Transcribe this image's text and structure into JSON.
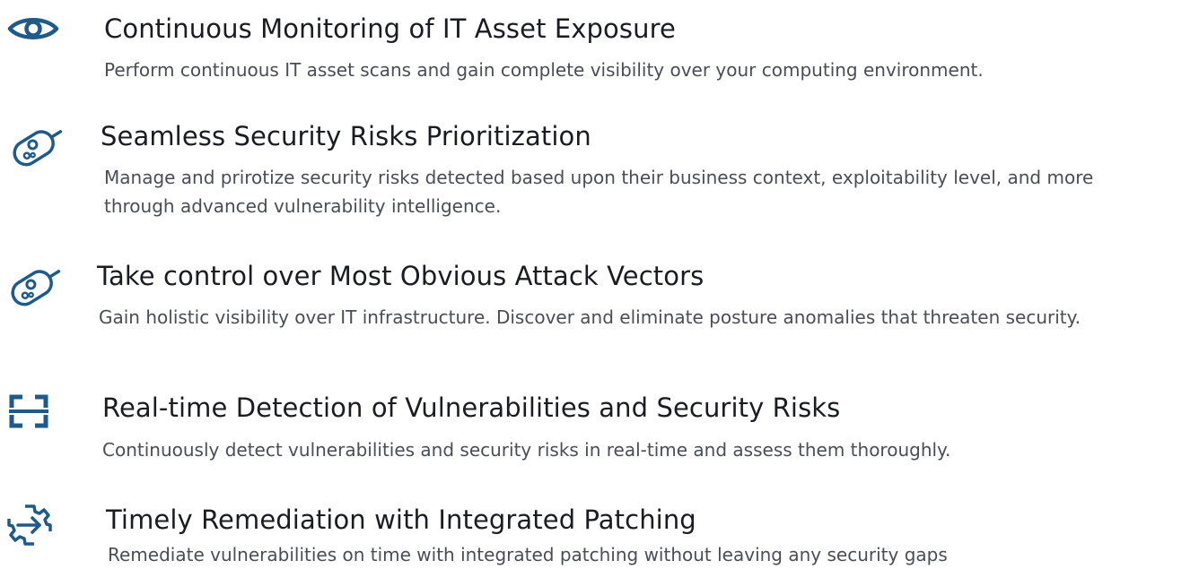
{
  "accent_color": "#1e5a8a",
  "features": [
    {
      "icon": "eye-icon",
      "title": "Continuous Monitoring of IT Asset Exposure",
      "description": "Perform continuous IT asset scans and gain complete visibility over your computing environment."
    },
    {
      "icon": "risk-meter-icon",
      "title": "Seamless Security Risks Prioritization",
      "description": "Manage and prirotize security risks detected based upon their business context, exploitability level, and more through advanced vulnerability intelligence."
    },
    {
      "icon": "risk-meter-icon",
      "title": "Take control over Most Obvious Attack Vectors",
      "description": "Gain holistic visibility over IT infrastructure. Discover and eliminate posture anomalies that threaten security."
    },
    {
      "icon": "scan-frame-icon",
      "title": "Real-time Detection of Vulnerabilities and Security Risks",
      "description": "Continuously detect vulnerabilities and security risks in real-time and assess them thoroughly."
    },
    {
      "icon": "gear-arrow-icon",
      "title": "Timely Remediation with Integrated Patching",
      "description": "Remediate vulnerabilities on time with integrated patching without leaving any security gaps"
    }
  ]
}
